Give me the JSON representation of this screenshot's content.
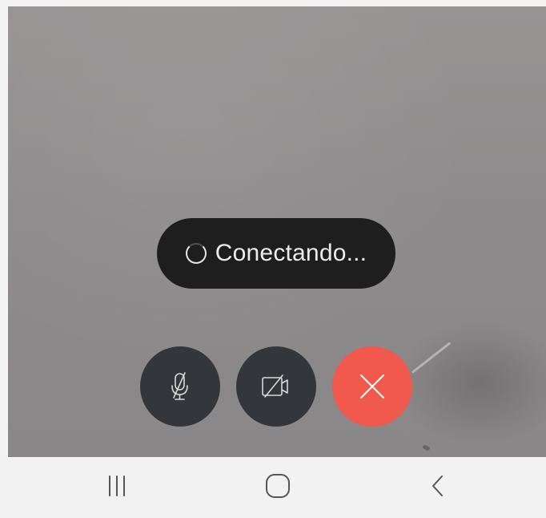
{
  "call": {
    "status_text": "Conectando...",
    "status_icon": "loading-spinner-icon",
    "controls": [
      {
        "name": "mic-button",
        "icon": "mic-off-icon",
        "state": "muted",
        "color": "#33363a"
      },
      {
        "name": "camera-button",
        "icon": "video-off-icon",
        "state": "off",
        "color": "#33363a"
      },
      {
        "name": "hangup-button",
        "icon": "close-icon",
        "color": "#f0594c"
      }
    ]
  },
  "navigation_bar": {
    "buttons": [
      {
        "name": "recents-button",
        "icon": "recents-icon"
      },
      {
        "name": "home-button",
        "icon": "home-icon"
      },
      {
        "name": "back-button",
        "icon": "back-chevron-icon"
      }
    ]
  },
  "colors": {
    "pill_background": "#1e1e1f",
    "control_background": "#33363a",
    "hangup_red": "#f0594c",
    "nav_background": "#f2f2f2"
  }
}
